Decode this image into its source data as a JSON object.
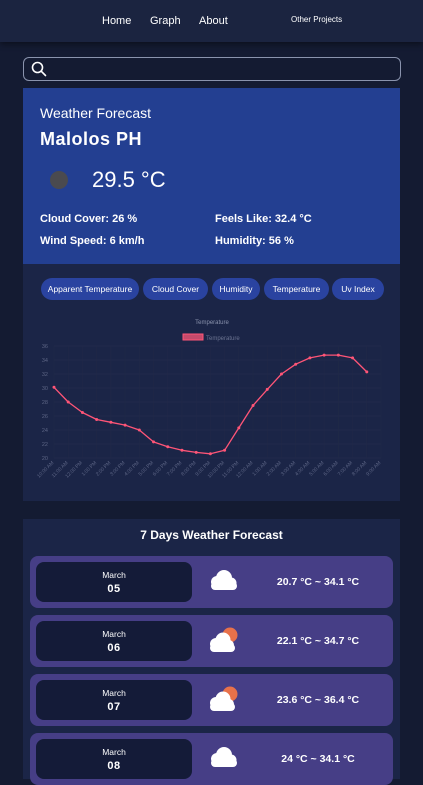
{
  "nav": {
    "home": "Home",
    "graph": "Graph",
    "about": "About",
    "other": "Other Projects"
  },
  "search": {
    "placeholder": "",
    "value": ""
  },
  "weather": {
    "title": "Weather Forecast",
    "location": "Malolos PH",
    "icon": "moon-icon",
    "temperature": "29.5 °C",
    "cloud_cover": "Cloud Cover: 26 %",
    "feels_like": "Feels Like: 32.4 °C",
    "wind_speed": "Wind Speed: 6 km/h",
    "humidity": "Humidity: 56 %"
  },
  "tabs": [
    "Apparent Temperature",
    "Cloud Cover",
    "Humidity",
    "Temperature",
    "Uv Index"
  ],
  "chart_data": {
    "type": "line",
    "title": "Temperature",
    "legend": "Temperature",
    "series_color": "#ff5577",
    "ylim": [
      20,
      36
    ],
    "yticks": [
      20,
      22,
      24,
      26,
      28,
      30,
      32,
      34,
      36
    ],
    "categories": [
      "10:00 AM",
      "11:00 AM",
      "12:00 PM",
      "1:00 PM",
      "2:00 PM",
      "3:00 PM",
      "4:00 PM",
      "5:00 PM",
      "6:00 PM",
      "7:00 PM",
      "8:00 PM",
      "9:00 PM",
      "10:00 PM",
      "11:00 PM",
      "12:00 AM",
      "1:00 AM",
      "2:00 AM",
      "3:00 AM",
      "4:00 AM",
      "5:00 AM",
      "6:00 AM",
      "7:00 AM",
      "8:00 AM",
      "9:00 AM"
    ],
    "values": [
      30.1,
      28.0,
      26.5,
      25.5,
      25.1,
      24.7,
      24.0,
      22.3,
      21.6,
      21.1,
      20.8,
      20.6,
      21.1,
      24.3,
      27.5,
      29.8,
      32.0,
      33.4,
      34.3,
      34.7,
      34.7,
      34.3,
      32.3
    ]
  },
  "forecast": {
    "title": "7 Days Weather Forecast",
    "days": [
      {
        "month": "March",
        "day": "05",
        "icon": "cloud-icon",
        "range": "20.7 °C ~ 34.1 °C"
      },
      {
        "month": "March",
        "day": "06",
        "icon": "partly-cloudy-icon",
        "range": "22.1 °C ~ 34.7 °C"
      },
      {
        "month": "March",
        "day": "07",
        "icon": "partly-cloudy-icon",
        "range": "23.6 °C ~ 36.4 °C"
      },
      {
        "month": "March",
        "day": "08",
        "icon": "cloud-icon",
        "range": "24 °C ~ 34.1 °C"
      }
    ]
  },
  "colors": {
    "background": "#141b32",
    "card": "#233f91",
    "tab": "#2a43a0",
    "forecast_row": "#463e86",
    "date_box": "#141b38",
    "line": "#ff5577"
  }
}
